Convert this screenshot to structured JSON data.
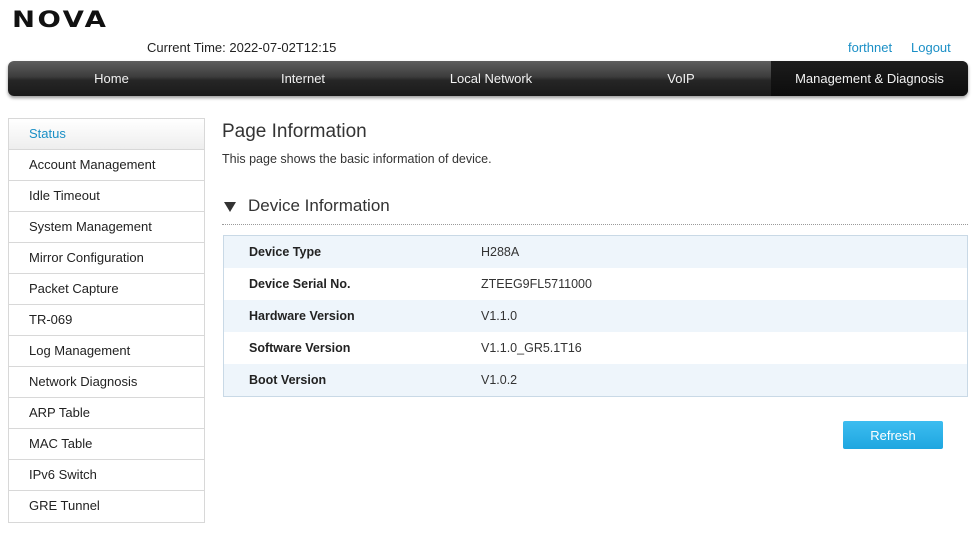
{
  "brand": {
    "logo_text": "NOVA"
  },
  "header": {
    "current_time_label": "Current Time: 2022-07-02T12:15",
    "user_link": "forthnet",
    "logout_link": "Logout"
  },
  "nav": {
    "items": [
      {
        "label": "Home"
      },
      {
        "label": "Internet"
      },
      {
        "label": "Local Network"
      },
      {
        "label": "VoIP"
      },
      {
        "label": "Management & Diagnosis",
        "active": true
      }
    ]
  },
  "sidebar": {
    "items": [
      {
        "label": "Status",
        "active": true
      },
      {
        "label": "Account Management"
      },
      {
        "label": "Idle Timeout"
      },
      {
        "label": "System Management"
      },
      {
        "label": "Mirror Configuration"
      },
      {
        "label": "Packet Capture"
      },
      {
        "label": "TR-069"
      },
      {
        "label": "Log Management"
      },
      {
        "label": "Network Diagnosis"
      },
      {
        "label": "ARP Table"
      },
      {
        "label": "MAC Table"
      },
      {
        "label": "IPv6 Switch"
      },
      {
        "label": "GRE Tunnel"
      }
    ]
  },
  "main": {
    "title": "Page Information",
    "description": "This page shows the basic information of device.",
    "section": {
      "title": "Device Information",
      "rows": [
        {
          "label": "Device Type",
          "value": "H288A"
        },
        {
          "label": "Device Serial No.",
          "value": "ZTEEG9FL5711000"
        },
        {
          "label": "Hardware Version",
          "value": "V1.1.0"
        },
        {
          "label": "Software Version",
          "value": "V1.1.0_GR5.1T16"
        },
        {
          "label": "Boot Version",
          "value": "V1.0.2"
        }
      ]
    },
    "refresh_label": "Refresh"
  },
  "colors": {
    "accent": "#1a8fc6",
    "button": "#27aee6",
    "nav_bg": "#2a2a2a",
    "row_alt": "#eef5fb"
  }
}
